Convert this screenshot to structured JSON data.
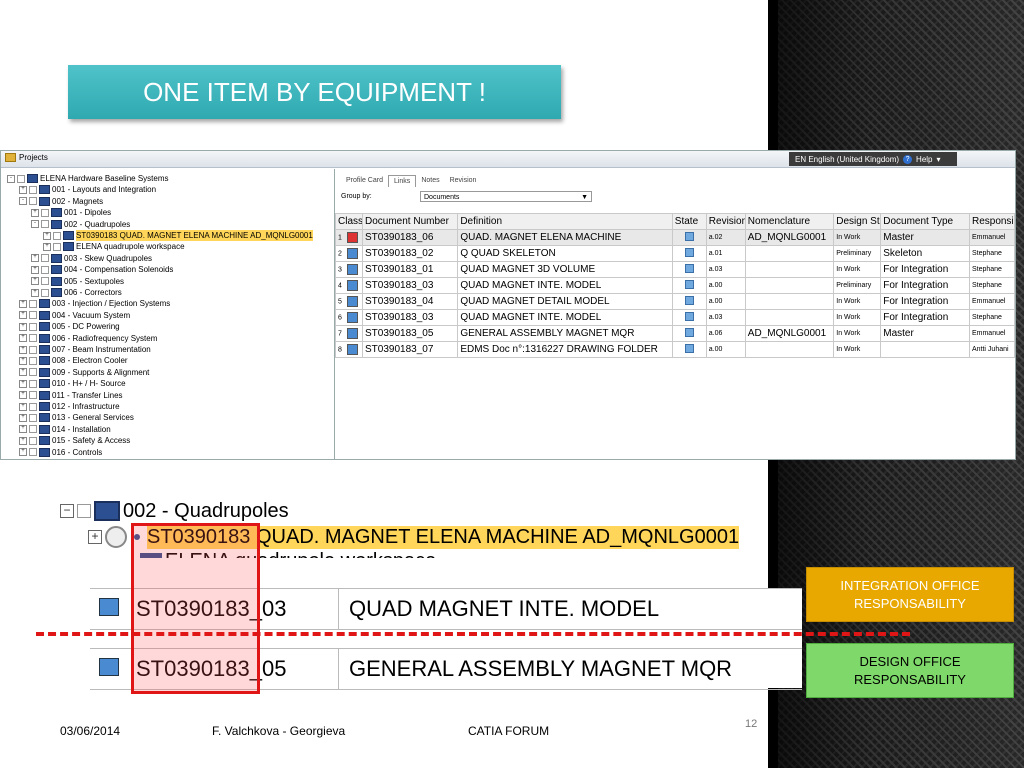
{
  "title": "ONE ITEM BY EQUIPMENT !",
  "app": {
    "projects_label": "Projects",
    "language": "EN English (United Kingdom)",
    "help": "Help"
  },
  "tree": [
    {
      "indent": 0,
      "exp": "-",
      "label": "ELENA Hardware Baseline Systems"
    },
    {
      "indent": 1,
      "exp": "+",
      "label": "001 - Layouts and Integration"
    },
    {
      "indent": 1,
      "exp": "-",
      "label": "002 - Magnets"
    },
    {
      "indent": 2,
      "exp": "+",
      "label": "001 - Dipoles"
    },
    {
      "indent": 2,
      "exp": "-",
      "label": "002 - Quadrupoles"
    },
    {
      "indent": 3,
      "exp": "+",
      "label": "ST0390183 QUAD. MAGNET ELENA MACHINE AD_MQNLG0001",
      "selected": true
    },
    {
      "indent": 3,
      "exp": "+",
      "label": "ELENA quadrupole workspace"
    },
    {
      "indent": 2,
      "exp": "+",
      "label": "003 - Skew Quadrupoles"
    },
    {
      "indent": 2,
      "exp": "+",
      "label": "004 - Compensation Solenoids"
    },
    {
      "indent": 2,
      "exp": "+",
      "label": "005 - Sextupoles"
    },
    {
      "indent": 2,
      "exp": "+",
      "label": "006 - Correctors"
    },
    {
      "indent": 1,
      "exp": "+",
      "label": "003 - Injection / Ejection Systems"
    },
    {
      "indent": 1,
      "exp": "+",
      "label": "004 - Vacuum System"
    },
    {
      "indent": 1,
      "exp": "+",
      "label": "005 - DC Powering"
    },
    {
      "indent": 1,
      "exp": "+",
      "label": "006 - Radiofrequency System"
    },
    {
      "indent": 1,
      "exp": "+",
      "label": "007 - Beam Instrumentation"
    },
    {
      "indent": 1,
      "exp": "+",
      "label": "008 - Electron Cooler"
    },
    {
      "indent": 1,
      "exp": "+",
      "label": "009 - Supports & Alignment"
    },
    {
      "indent": 1,
      "exp": "+",
      "label": "010 - H+ / H- Source"
    },
    {
      "indent": 1,
      "exp": "+",
      "label": "011 - Transfer Lines"
    },
    {
      "indent": 1,
      "exp": "+",
      "label": "012 - Infrastructure"
    },
    {
      "indent": 1,
      "exp": "+",
      "label": "013 - General Services"
    },
    {
      "indent": 1,
      "exp": "+",
      "label": "014 - Installation"
    },
    {
      "indent": 1,
      "exp": "+",
      "label": "015 - Safety & Access"
    },
    {
      "indent": 1,
      "exp": "+",
      "label": "016 - Controls"
    }
  ],
  "tabs": [
    "Profile Card",
    "Links",
    "Notes",
    "Revision"
  ],
  "active_tab": "Links",
  "group_by_label": "Group by:",
  "group_by_value": "Documents",
  "columns": [
    "Class",
    "Document Number",
    "Definition",
    "State",
    "Revision",
    "Nomenclature",
    "Design State",
    "Document Type",
    "Responsible"
  ],
  "rows": [
    [
      "1",
      "ST0390183_06",
      "QUAD. MAGNET ELENA MACHINE",
      "",
      "a.02",
      "AD_MQNLG0001",
      "In Work",
      "Master",
      "Emmanuel"
    ],
    [
      "2",
      "ST0390183_02",
      "Q QUAD SKELETON",
      "",
      "a.01",
      "",
      "Preliminary",
      "Skeleton",
      "Stephane"
    ],
    [
      "3",
      "ST0390183_01",
      "QUAD MAGNET 3D VOLUME",
      "",
      "a.03",
      "",
      "In Work",
      "For Integration",
      "Stephane"
    ],
    [
      "4",
      "ST0390183_03",
      "QUAD MAGNET INTE. MODEL",
      "",
      "a.00",
      "",
      "Preliminary",
      "For Integration",
      "Stephane"
    ],
    [
      "5",
      "ST0390183_04",
      "QUAD MAGNET DETAIL MODEL",
      "",
      "a.00",
      "",
      "In Work",
      "For Integration",
      "Emmanuel"
    ],
    [
      "6",
      "ST0390183_03",
      "QUAD MAGNET INTE. MODEL",
      "",
      "a.03",
      "",
      "In Work",
      "For Integration",
      "Stephane"
    ],
    [
      "7",
      "ST0390183_05",
      "GENERAL ASSEMBLY MAGNET MQR",
      "",
      "a.06",
      "AD_MQNLG0001",
      "In Work",
      "Master",
      "Emmanuel"
    ],
    [
      "8",
      "ST0390183_07",
      "EDMS Doc n°:1316227 DRAWING FOLDER",
      "",
      "a.00",
      "",
      "In Work",
      "",
      "Antti Juhani"
    ]
  ],
  "zoom_tree": {
    "parent": "002 - Quadrupoles",
    "item": "ST0390183 QUAD. MAGNET ELENA MACHINE AD_MQNLG0001",
    "partial": "ELENA quadrupole workspace"
  },
  "zoom_rows": [
    {
      "number": "ST0390183_03",
      "definition": "QUAD MAGNET INTE. MODEL"
    },
    {
      "number": "ST0390183_05",
      "definition": "GENERAL ASSEMBLY MAGNET MQR"
    }
  ],
  "integration_box": {
    "line1": "INTEGRATION  OFFICE",
    "line2": "RESPONSABILITY"
  },
  "design_box": {
    "line1": "DESIGN OFFICE",
    "line2": "RESPONSABILITY"
  },
  "footer": {
    "date": "03/06/2014",
    "author": "F. Valchkova - Georgieva",
    "event": "CATIA FORUM",
    "page": "12"
  },
  "colors": {
    "title_bg": "#3bb5bc",
    "integration": "#e8a800",
    "design": "#7fd86a",
    "highlight": "#ffd659",
    "red": "#e01616"
  }
}
